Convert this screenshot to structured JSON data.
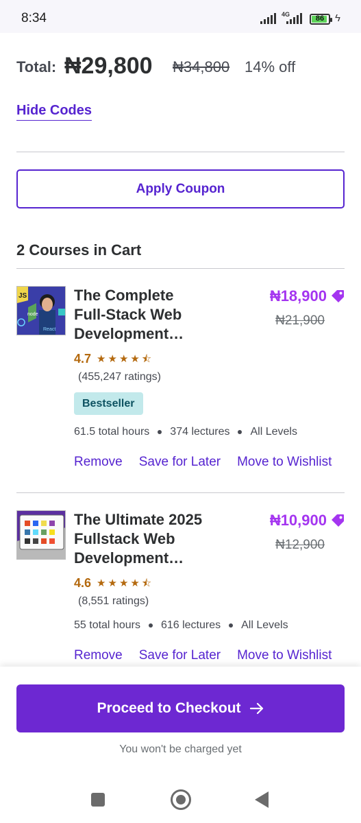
{
  "status_bar": {
    "time": "8:34",
    "network": "4G",
    "battery": "86"
  },
  "summary": {
    "total_label": "Total:",
    "total_price": "₦29,800",
    "original_price": "₦34,800",
    "discount": "14% off",
    "hide_codes": "Hide Codes"
  },
  "coupon": {
    "button_label": "Apply Coupon"
  },
  "cart": {
    "heading": "2 Courses in Cart",
    "courses": [
      {
        "title_line1": "The Complete",
        "title_line2": "Full-Stack Web",
        "title_line3": "Development…",
        "price": "₦18,900",
        "original_price": "₦21,900",
        "rating": "4.7",
        "rating_stars": 4.5,
        "ratings_count": "(455,247 ratings)",
        "badge": "Bestseller",
        "hours": "61.5 total hours",
        "lectures": "374 lectures",
        "level": "All Levels",
        "thumb_node_label": "node",
        "thumb_react_label": "React",
        "thumb_js_label": "JS"
      },
      {
        "title_line1": "The Ultimate 2025",
        "title_line2": "Fullstack Web",
        "title_line3": "Development…",
        "price": "₦10,900",
        "original_price": "₦12,900",
        "rating": "4.6",
        "rating_stars": 4.5,
        "ratings_count": "(8,551 ratings)",
        "hours": "55 total hours",
        "lectures": "616 lectures",
        "level": "All Levels"
      }
    ],
    "actions": {
      "remove": "Remove",
      "save_for_later": "Save for Later",
      "move_to_wishlist": "Move to Wishlist"
    }
  },
  "checkout": {
    "button_label": "Proceed to Checkout",
    "note": "You won't be charged yet"
  },
  "colors": {
    "accent": "#5624d0",
    "checkout": "#6d28d2",
    "price": "#a435f0",
    "rating": "#b4690e",
    "badge_bg": "#c2e9eb"
  },
  "icons": [
    "tag-icon",
    "arrow-right-icon",
    "star-icon",
    "star-half-icon",
    "home-icon",
    "back-icon",
    "recents-icon"
  ]
}
